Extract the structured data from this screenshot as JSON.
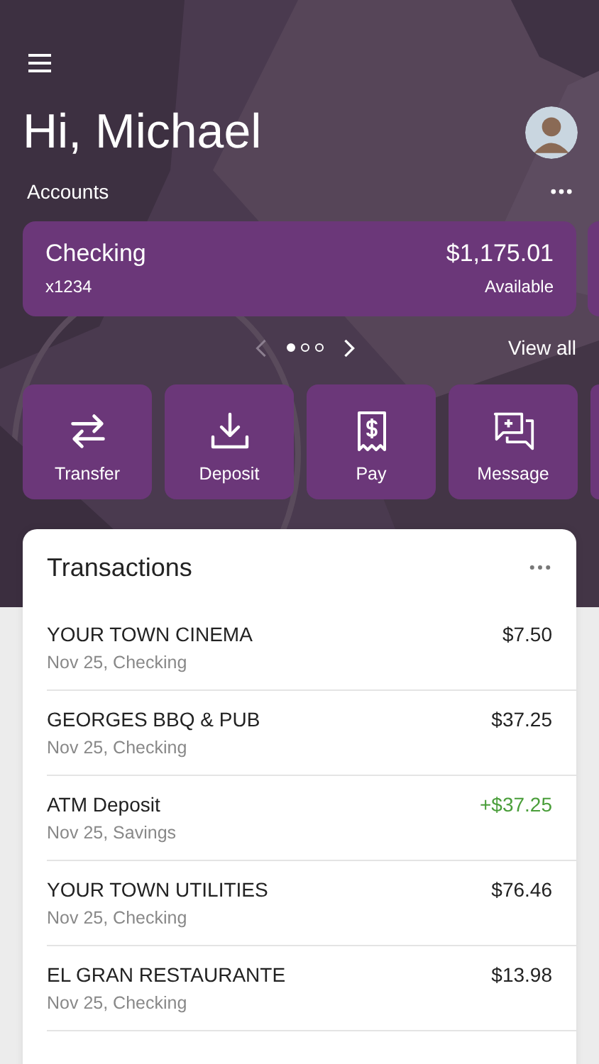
{
  "header": {
    "greeting": "Hi, Michael",
    "accounts_label": "Accounts"
  },
  "accounts": [
    {
      "name": "Checking",
      "number": "x1234",
      "balance": "$1,175.01",
      "balance_label": "Available"
    }
  ],
  "pager": {
    "pages": [
      {
        "selected": true
      },
      {
        "selected": false
      },
      {
        "selected": false
      }
    ],
    "view_all": "View all"
  },
  "actions": [
    {
      "label": "Transfer",
      "kind": "transfer"
    },
    {
      "label": "Deposit",
      "kind": "deposit"
    },
    {
      "label": "Pay",
      "kind": "pay"
    },
    {
      "label": "Message",
      "kind": "message"
    }
  ],
  "transactions": {
    "title": "Transactions",
    "rows": [
      {
        "payee": "YOUR TOWN CINEMA",
        "detail": "Nov 25, Checking",
        "amount": "$7.50",
        "kind": "debit"
      },
      {
        "payee": "GEORGES BBQ & PUB",
        "detail": "Nov 25, Checking",
        "amount": "$37.25",
        "kind": "debit"
      },
      {
        "payee": "ATM Deposit",
        "detail": "Nov 25, Savings",
        "amount": "+$37.25",
        "kind": "credit"
      },
      {
        "payee": "YOUR TOWN UTILITIES",
        "detail": "Nov 25, Checking",
        "amount": "$76.46",
        "kind": "debit"
      },
      {
        "payee": "EL GRAN RESTAURANTE",
        "detail": "Nov 25, Checking",
        "amount": "$13.98",
        "kind": "debit"
      }
    ]
  }
}
